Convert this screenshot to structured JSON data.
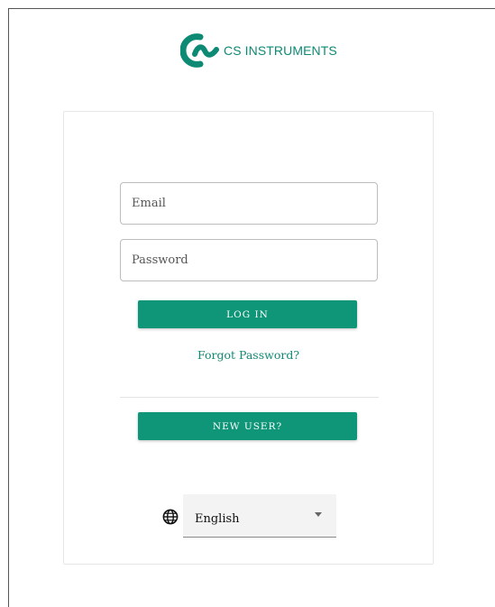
{
  "brand": {
    "name": "CS INSTRUMENTS",
    "color": "#0d8a74",
    "logo_icon": "cs-logo-icon"
  },
  "login_form": {
    "email_placeholder": "Email",
    "email_value": "",
    "password_placeholder": "Password",
    "password_value": "",
    "login_label": "LOG IN",
    "forgot_label": "Forgot Password?",
    "new_user_label": "NEW USER?"
  },
  "language": {
    "icon": "globe-icon",
    "selected": "English"
  },
  "colors": {
    "accent": "#0f9678",
    "link": "#0f8a74"
  }
}
